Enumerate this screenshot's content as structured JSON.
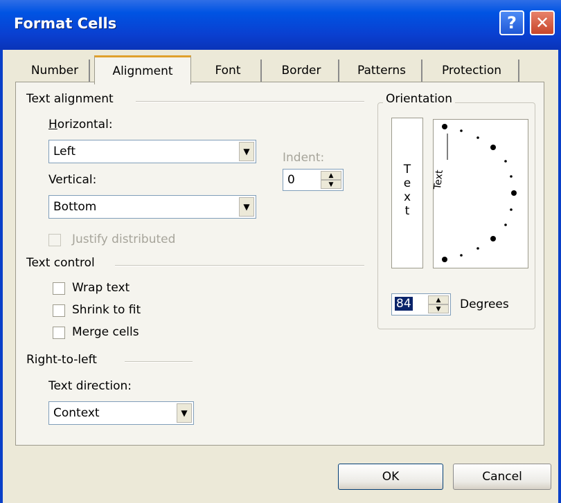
{
  "window": {
    "title": "Format Cells",
    "help_glyph": "?",
    "close_glyph": "✕"
  },
  "tabs": [
    {
      "label": "Number",
      "active": false
    },
    {
      "label": "Alignment",
      "active": true
    },
    {
      "label": "Font",
      "active": false
    },
    {
      "label": "Border",
      "active": false
    },
    {
      "label": "Patterns",
      "active": false
    },
    {
      "label": "Protection",
      "active": false
    }
  ],
  "text_alignment": {
    "group_label": "Text alignment",
    "horizontal_label": "Horizontal:",
    "horizontal_value": "Left",
    "vertical_label": "Vertical:",
    "vertical_value": "Bottom",
    "indent_label": "Indent:",
    "indent_value": "0",
    "justify_distributed_label": "Justify distributed",
    "justify_distributed_checked": false
  },
  "text_control": {
    "group_label": "Text control",
    "wrap_text_label": "Wrap text",
    "wrap_text_checked": false,
    "shrink_to_fit_label": "Shrink to fit",
    "shrink_to_fit_checked": false,
    "merge_cells_label": "Merge cells",
    "merge_cells_checked": false
  },
  "right_to_left": {
    "group_label": "Right-to-left",
    "text_direction_label": "Text direction:",
    "text_direction_value": "Context"
  },
  "orientation": {
    "group_label": "Orientation",
    "vertical_text_letters": [
      "T",
      "e",
      "x",
      "t"
    ],
    "dial_text": "Text",
    "degrees_value": "84",
    "degrees_label": "Degrees"
  },
  "buttons": {
    "ok_label": "OK",
    "cancel_label": "Cancel"
  },
  "colors": {
    "titlebar": "#0054e3",
    "dialog_background": "#ece9d8",
    "active_tab_accent": "#e0a02c"
  }
}
